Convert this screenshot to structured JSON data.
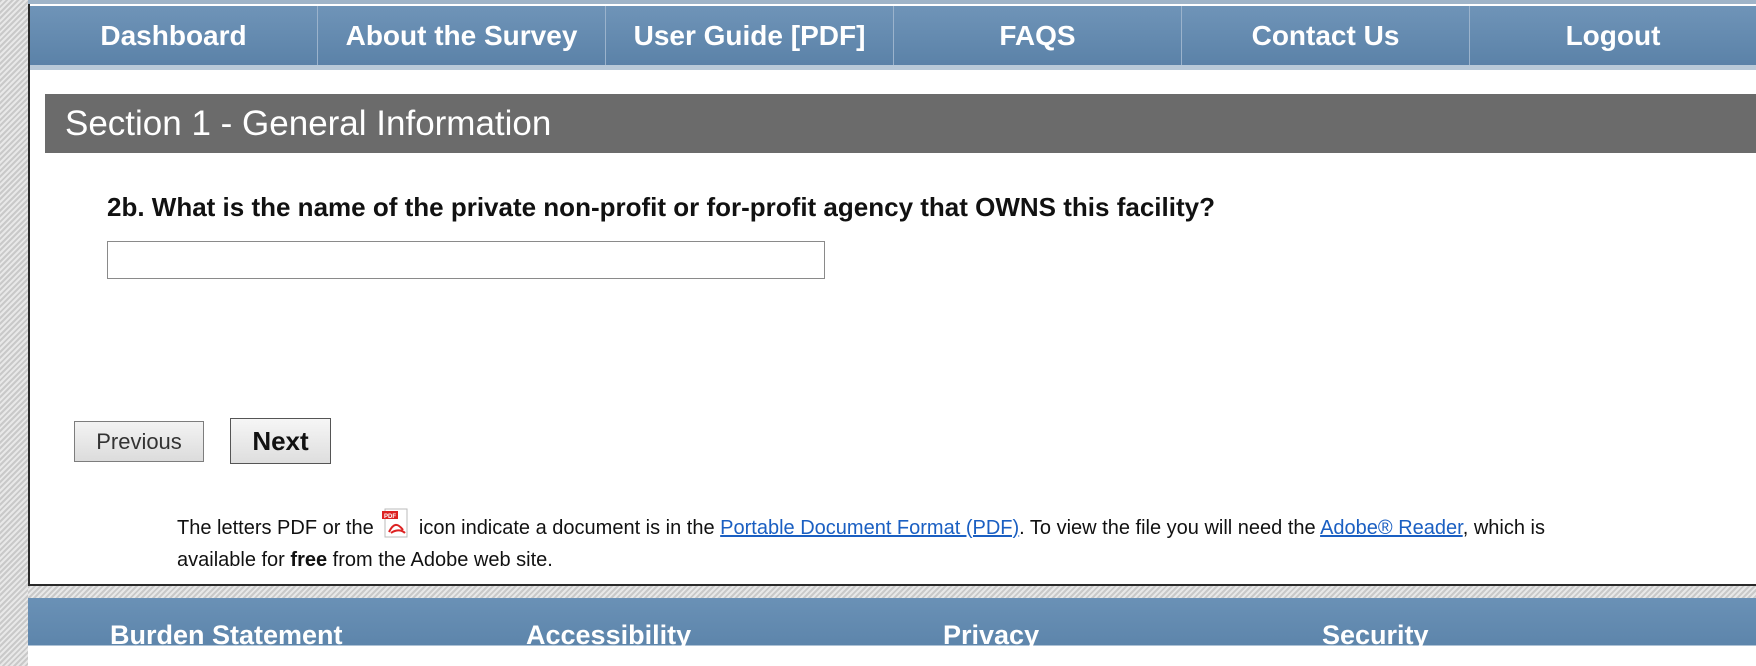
{
  "nav": {
    "items": [
      {
        "label": "Dashboard"
      },
      {
        "label": "About the Survey"
      },
      {
        "label": "User Guide [PDF]"
      },
      {
        "label": "FAQS"
      },
      {
        "label": "Contact Us"
      },
      {
        "label": "Logout"
      }
    ]
  },
  "section": {
    "title": "Section 1 - General Information"
  },
  "question": {
    "label": "2b. What is the name of the private non-profit or for-profit agency that OWNS this facility?",
    "value": "",
    "placeholder": ""
  },
  "buttons": {
    "previous": "Previous",
    "next": "Next"
  },
  "pdf_note": {
    "text1": "The letters PDF or the",
    "icon": "pdf-icon",
    "text2": "icon indicate a document is in the",
    "link1": "Portable Document Format (PDF)",
    "text3": ". To view the file you will need the",
    "link2": "Adobe® Reader",
    "text4": ", which is available for",
    "bold": "free",
    "text5": "from the Adobe web site."
  },
  "footer": {
    "burden": "Burden Statement",
    "accessibility": "Accessibility",
    "privacy": "Privacy",
    "security": "Security"
  },
  "colors": {
    "nav_bg": "#5b82a8",
    "section_bg": "#6b6b6b",
    "link": "#1a5fc2"
  }
}
